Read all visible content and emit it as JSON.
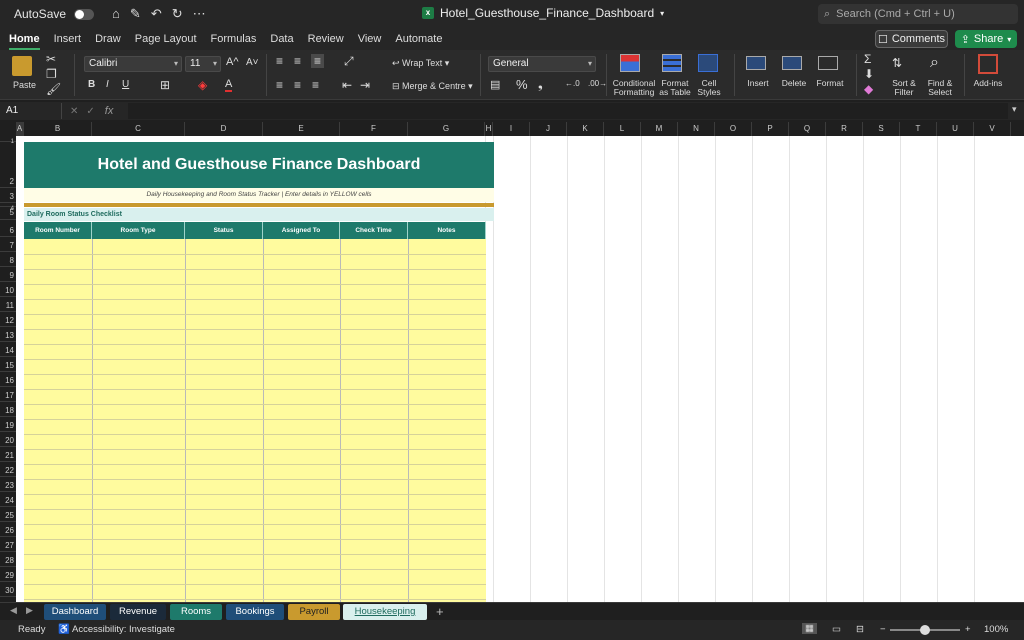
{
  "titlebar": {
    "autosave_label": "AutoSave",
    "file_name": "Hotel_Guesthouse_Finance_Dashboard",
    "search_placeholder": "Search (Cmd + Ctrl + U)"
  },
  "menu": {
    "tabs": [
      "Home",
      "Insert",
      "Draw",
      "Page Layout",
      "Formulas",
      "Data",
      "Review",
      "View",
      "Automate"
    ],
    "active": "Home",
    "comments_label": "Comments",
    "share_label": "Share"
  },
  "ribbon": {
    "paste_label": "Paste",
    "font_name": "Calibri",
    "font_size": "11",
    "wrap_text_label": "Wrap Text",
    "merge_label": "Merge & Centre",
    "number_format": "General",
    "conditional_label": "Conditional Formatting",
    "format_table_label": "Format as Table",
    "cell_styles_label": "Cell Styles",
    "insert_label": "Insert",
    "delete_label": "Delete",
    "format_label": "Format",
    "sort_label": "Sort & Filter",
    "find_label": "Find & Select",
    "addins_label": "Add-ins"
  },
  "formula_bar": {
    "name_box": "A1",
    "fx": "fx"
  },
  "columns": [
    "A",
    "B",
    "C",
    "D",
    "E",
    "F",
    "G",
    "H",
    "I",
    "J",
    "K",
    "L",
    "M",
    "N",
    "O",
    "P",
    "Q",
    "R",
    "S",
    "T",
    "U",
    "V"
  ],
  "rows": [
    "1",
    "2",
    "3",
    "4",
    "5",
    "6",
    "7",
    "8",
    "9",
    "10",
    "11",
    "12",
    "13",
    "14",
    "15",
    "16",
    "17",
    "18",
    "19",
    "20",
    "21",
    "22",
    "23",
    "24",
    "25",
    "26",
    "27",
    "28",
    "29",
    "30"
  ],
  "sheet": {
    "title": "Hotel and Guesthouse Finance Dashboard",
    "subtitle": "Daily Housekeeping and Room Status Tracker  |  Enter details in YELLOW cells",
    "section": "Daily Room Status Checklist",
    "headers": [
      "Room Number",
      "Room Type",
      "Status",
      "Assigned To",
      "Check Time",
      "Notes"
    ]
  },
  "sheet_tabs": [
    {
      "label": "Dashboard",
      "color": "#1f4e79"
    },
    {
      "label": "Revenue",
      "color": "#1b2a3a"
    },
    {
      "label": "Rooms",
      "color": "#1e7a6b"
    },
    {
      "label": "Bookings",
      "color": "#1f4e79"
    },
    {
      "label": "Payroll",
      "color": "#c99a2e"
    },
    {
      "label": "Housekeeping",
      "color": "#d9f0ee"
    }
  ],
  "status": {
    "ready": "Ready",
    "accessibility": "Accessibility: Investigate",
    "zoom": "100%"
  }
}
